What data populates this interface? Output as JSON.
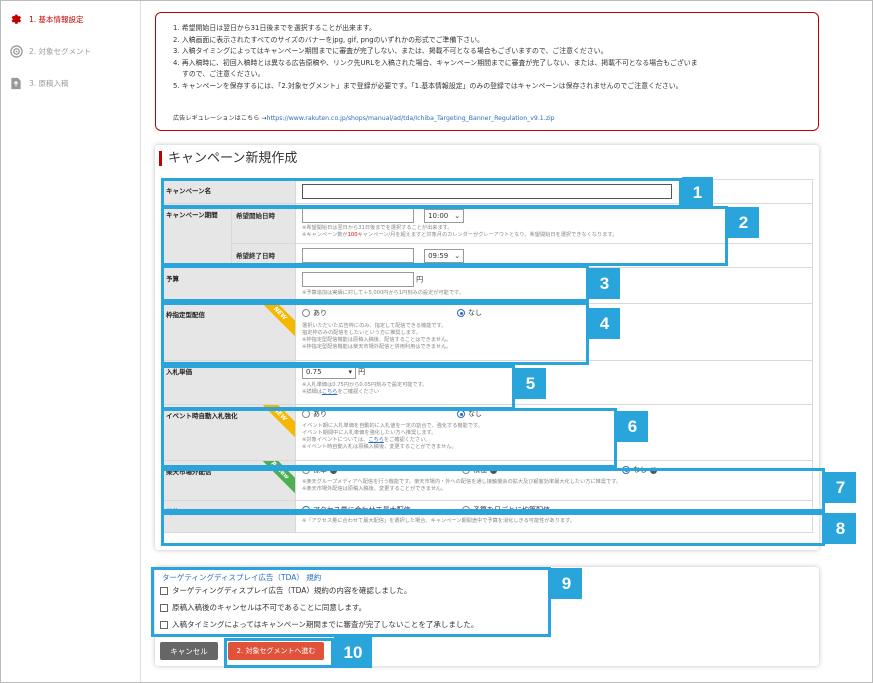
{
  "sidebar": {
    "items": [
      {
        "label": "1. 基本情報設定",
        "icon": "gear-icon"
      },
      {
        "label": "2. 対象セグメント",
        "icon": "target-icon"
      },
      {
        "label": "3. 原稿入稿",
        "icon": "upload-file-icon"
      }
    ]
  },
  "notice": {
    "lines": [
      "1. 希望開始日は翌日から31日後までを選択することが出来ます。",
      "2. 入稿画面に表示されたすべてのサイズのバナーをjpg, gif, pngのいずれかの形式でご準備下さい。",
      "3. 入稿タイミングによってはキャンペーン期間までに審査が完了しない、または、掲載不可となる場合もございますので、ご注意ください。",
      "4. 再入稿時に、初回入稿時とは異なる広告原稿や、リンク先URLを入稿された場合、キャンペーン期間までに審査が完了しない、または、掲載不可となる場合もございま",
      "   すので、ご注意ください。",
      "5. キャンペーンを保存するには、「2.対象セグメント」まで登録が必要です。「1.基本情報設定」のみの登録ではキャンペーンは保存されませんのでご注意ください。"
    ],
    "regulation_prefix": "広告レギュレーションはこちら →",
    "regulation_link": "https://www.rakuten.co.jp/shops/manual/ad/tda/Ichiba_Targeting_Banner_Regulation_v9.1.zip"
  },
  "form": {
    "title": "キャンペーン新規作成",
    "campaign_name": {
      "label": "キャンペーン名",
      "value": ""
    },
    "period": {
      "label": "キャンペーン期間",
      "start_label": "希望開始日時",
      "start_time": "10:00",
      "start_note_1": "※希望開始日は翌日から31日後までを選択することが出来ます。",
      "start_note_2_a": "※キャンペーン数が",
      "start_note_2_red": "100",
      "start_note_2_b": "キャンペーン/月を超えますと対象月のカレンダーがグレーアウトとなり、希望開始日を選択できなくなります。",
      "end_label": "希望終了日時",
      "end_time": "09:59"
    },
    "budget": {
      "label": "予算",
      "unit": "円",
      "note": "※予算追加は実績に対して＋5,000円から1円刻みの設定が可能です。"
    },
    "slot": {
      "label": "枠指定型配信",
      "badge": "NEW",
      "opt_yes": "あり",
      "opt_no": "なし",
      "selected": "なし",
      "note_1": "選択いただいた広告枠にのみ、指定して配信できる機能です。",
      "note_2": "指定枠のみの配信をしたいという方に推奨します。",
      "note_3": "※枠指定型配信機能は原稿入稿後、配信することはできません。",
      "note_4": "※枠指定型配信機能は楽天市場外配信と併用利用はできません。"
    },
    "bid": {
      "label": "入札単価",
      "value": "0.75",
      "unit": "円",
      "note_1": "※入札単価は0.75円から0.05円刻みで設定可能です。",
      "note_2_a": "※詳細は",
      "note_2_link": "こちら",
      "note_2_b": "をご確認ください"
    },
    "auto_bid": {
      "label": "イベント時自動入札強化",
      "badge": "NEW",
      "opt_yes": "あり",
      "opt_no": "なし",
      "selected": "なし",
      "note_1": "イベント期に入札単価を自動的に入札値を一定の割合で、強化する機能です。",
      "note_2": "イベント期間中に入札単価を強化したい方へ推奨します。",
      "note_3_a": "※対象イベントについては、",
      "note_3_link": "こちら",
      "note_3_b": "をご確認ください。",
      "note_4": "※イベント時自動入札は原稿入稿後、変更することができません。"
    },
    "outside": {
      "label": "楽天市場外配信",
      "badge": "Renew",
      "opt_1": "標準",
      "opt_2": "積極",
      "opt_3": "なし",
      "selected": "なし",
      "note_1": "※楽天グループメディアへ配信を行う機能です。楽天市場内・外への配信を通し接触機会の拡大及び顧客効率最大化したい方に推奨です。",
      "note_2": "※楽天市場外配信は原稿入稿後、変更することができません。"
    },
    "delivery": {
      "label": "配信ペース",
      "opt_1": "アクセス量に合わせて最大配信",
      "opt_2": "予算を日ごとに均等配信",
      "selected": "アクセス量に合わせて最大配信",
      "note": "※「アクセス量に合わせて最大配信」を選択した場合、キャンペーン期間途中で予算を消化しきる可能性があります。"
    }
  },
  "terms": {
    "title": "ターゲティングディスプレイ広告（TDA） 規約",
    "checks": [
      "ターゲティングディスプレイ広告（TDA）規約の内容を確認しました。",
      "原稿入稿後のキャンセルは不可であることに同意します。",
      "入稿タイミングによってはキャンペーン期間までに審査が完了しないことを了承しました。"
    ]
  },
  "buttons": {
    "cancel": "キャンセル",
    "next": "2. 対象セグメントへ進む"
  },
  "callouts": [
    "1",
    "2",
    "3",
    "4",
    "5",
    "6",
    "7",
    "8",
    "9",
    "10"
  ],
  "colors": {
    "accent_red": "#bf0000",
    "callout_blue": "#29a5dc",
    "link_blue": "#2a6ebb",
    "next_button": "#e0533a",
    "new_badge": "#f5b700",
    "renew_badge": "#4caf50"
  }
}
